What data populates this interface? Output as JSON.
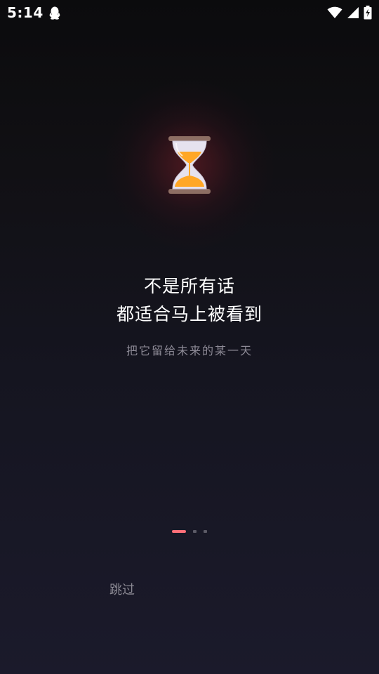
{
  "status_bar": {
    "time": "5:14",
    "icons": [
      "qq-icon",
      "wifi-icon",
      "cellular-signal-icon",
      "battery-charging-icon"
    ]
  },
  "onboarding": {
    "hero_icon": "hourglass-icon",
    "headline_line1": "不是所有话",
    "headline_line2": "都适合马上被看到",
    "subline": "把它留给未来的某一天",
    "page_indicator": {
      "current": 1,
      "total": 3
    },
    "skip_label": "跳过"
  },
  "colors": {
    "accent": "#ff6f78",
    "background_top": "#0b0b0d",
    "background_bottom": "#1b1a2b",
    "text_primary": "#ffffff",
    "text_secondary": "#8d8a96",
    "hourglass_sand": "#ffa726",
    "hourglass_frame": "#8d6e63"
  }
}
